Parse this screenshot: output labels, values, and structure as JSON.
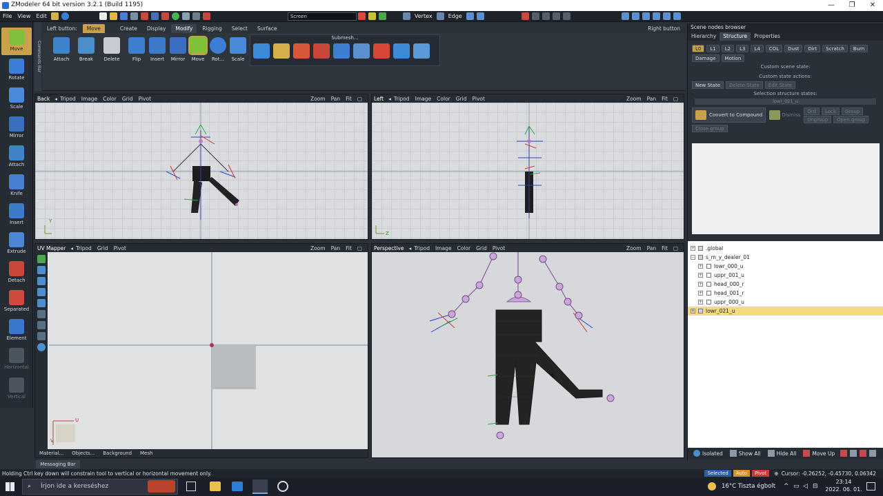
{
  "window": {
    "title": "ZModeler 64 bit version 3.2.1 (Build 1195)",
    "controls": [
      "—",
      "❐",
      "✕"
    ]
  },
  "menu": {
    "items": [
      "File",
      "View",
      "Edit"
    ],
    "screen_combo": "Screen",
    "vertex_label": "Vertex",
    "edge_label": "Edge"
  },
  "left_toolbar": {
    "items": [
      {
        "label": "Move",
        "icon": "move-icon",
        "color": "#7fc13a"
      },
      {
        "label": "Rotate",
        "icon": "rotate-icon",
        "color": "#3d7fd6"
      },
      {
        "label": "Scale",
        "icon": "scale-icon",
        "color": "#4a8bd8"
      },
      {
        "label": "Mirror",
        "icon": "mirror-icon",
        "color": "#3a6fc0"
      },
      {
        "label": "Attach",
        "icon": "attach-icon",
        "color": "#3d84c9"
      },
      {
        "label": "Knife",
        "icon": "knife-icon",
        "color": "#4a7fcf"
      },
      {
        "label": "Insert",
        "icon": "insert-icon",
        "color": "#3d7ac8"
      },
      {
        "label": "Extrude",
        "icon": "extrude-icon",
        "color": "#4d86d4"
      },
      {
        "label": "Detach",
        "icon": "detach-icon",
        "color": "#c8463a"
      },
      {
        "label": "Separated",
        "icon": "separated-icon",
        "color": "#cf4b3f"
      },
      {
        "label": "Element",
        "icon": "element-icon",
        "color": "#3a78cf"
      },
      {
        "label": "Horizontal",
        "icon": "horizontal-icon",
        "color": "#4a5560"
      },
      {
        "label": "Vertical",
        "icon": "vertical-icon",
        "color": "#4a5560"
      }
    ],
    "commands_bar": "Commands Bar"
  },
  "ribbon": {
    "left_button_label": "Left button:",
    "left_button_value": "Move",
    "right_button_label": "Right button",
    "tabs": [
      "Create",
      "Display",
      "Modify",
      "Rigging",
      "Select",
      "Surface"
    ],
    "active_tab": "Modify",
    "buttons": [
      "Attach",
      "Break",
      "Delete",
      "Flip",
      "Insert",
      "Mirror",
      "Move",
      "Rot...",
      "Scale"
    ],
    "submesh_label": "Submesh..."
  },
  "viewports": {
    "back": {
      "name": "Back",
      "items": [
        "Tripod",
        "Image",
        "Color",
        "Grid",
        "Pivot"
      ]
    },
    "left": {
      "name": "Left",
      "items": [
        "Tripod",
        "Image",
        "Color",
        "Grid",
        "Pivot"
      ]
    },
    "uv": {
      "name": "UV Mapper",
      "items": [
        "Tripod",
        "Grid",
        "Pivot"
      ]
    },
    "perspective": {
      "name": "Perspective",
      "items": [
        "Tripod",
        "Image",
        "Color",
        "Grid",
        "Pivot"
      ]
    },
    "right_controls": [
      "Zoom",
      "Pan",
      "Fit"
    ],
    "uv_bottom": [
      "Material...",
      "Objects...",
      "Background",
      "Mesh"
    ],
    "axis_y": "Y",
    "axis_z": "Z",
    "axis_u": "U",
    "axis_v": "V"
  },
  "scene_browser": {
    "title": "Scene nodes browser",
    "tabs": [
      "Hierarchy",
      "Structure",
      "Properties"
    ],
    "active_tab": "Structure",
    "lod_chips": [
      "L0",
      "L1",
      "L2",
      "L3",
      "L4",
      "COL",
      "Dust",
      "Dirt",
      "Scratch",
      "Burn"
    ],
    "damage": "Damage",
    "motion": "Motion",
    "custom_scene_state": "Custom scene state:",
    "custom_state_actions": "Custom state actions:",
    "state_buttons": [
      "New State",
      "Delete State",
      "Edit State"
    ],
    "selection_structure_states": "Selection structure states:",
    "selected_field": "lowr_021_u",
    "convert_button": "Convert to Compound",
    "dismiss": "Dismiss",
    "small_buttons": [
      "Ord",
      "Lock",
      "Group",
      "Ungroup",
      "Open group"
    ],
    "close_group": "Close group",
    "tree": [
      {
        "label": ".global",
        "level": 0
      },
      {
        "label": "s_m_y_dealer_01",
        "level": 0
      },
      {
        "label": "lowr_000_u",
        "level": 1
      },
      {
        "label": "uppr_001_u",
        "level": 1
      },
      {
        "label": "head_000_r",
        "level": 1
      },
      {
        "label": "head_001_r",
        "level": 1
      },
      {
        "label": "uppr_000_u",
        "level": 1
      },
      {
        "label": "lowr_021_u",
        "level": 0,
        "selected": true
      }
    ],
    "bottom": [
      "Isolated",
      "Show All",
      "Hide All",
      "Move Up"
    ]
  },
  "status": {
    "messaging_bar": "Messaging Bar",
    "hint": "Holding Ctrl key down will constrain tool to vertical or horizontal movement only.",
    "selected": "Selected",
    "auto": "Auto",
    "pivot": "Pivot",
    "cursor": "Cursor: -0.26252, -0.45730, 0.06342"
  },
  "taskbar": {
    "search_placeholder": "Írjon ide a kereséshez",
    "weather": "16°C  Tiszta égbolt",
    "time": "23:14",
    "date": "2022. 06. 01."
  },
  "colors": {
    "accent": "#c9a14a",
    "selection_row": "#f4dc7c"
  }
}
